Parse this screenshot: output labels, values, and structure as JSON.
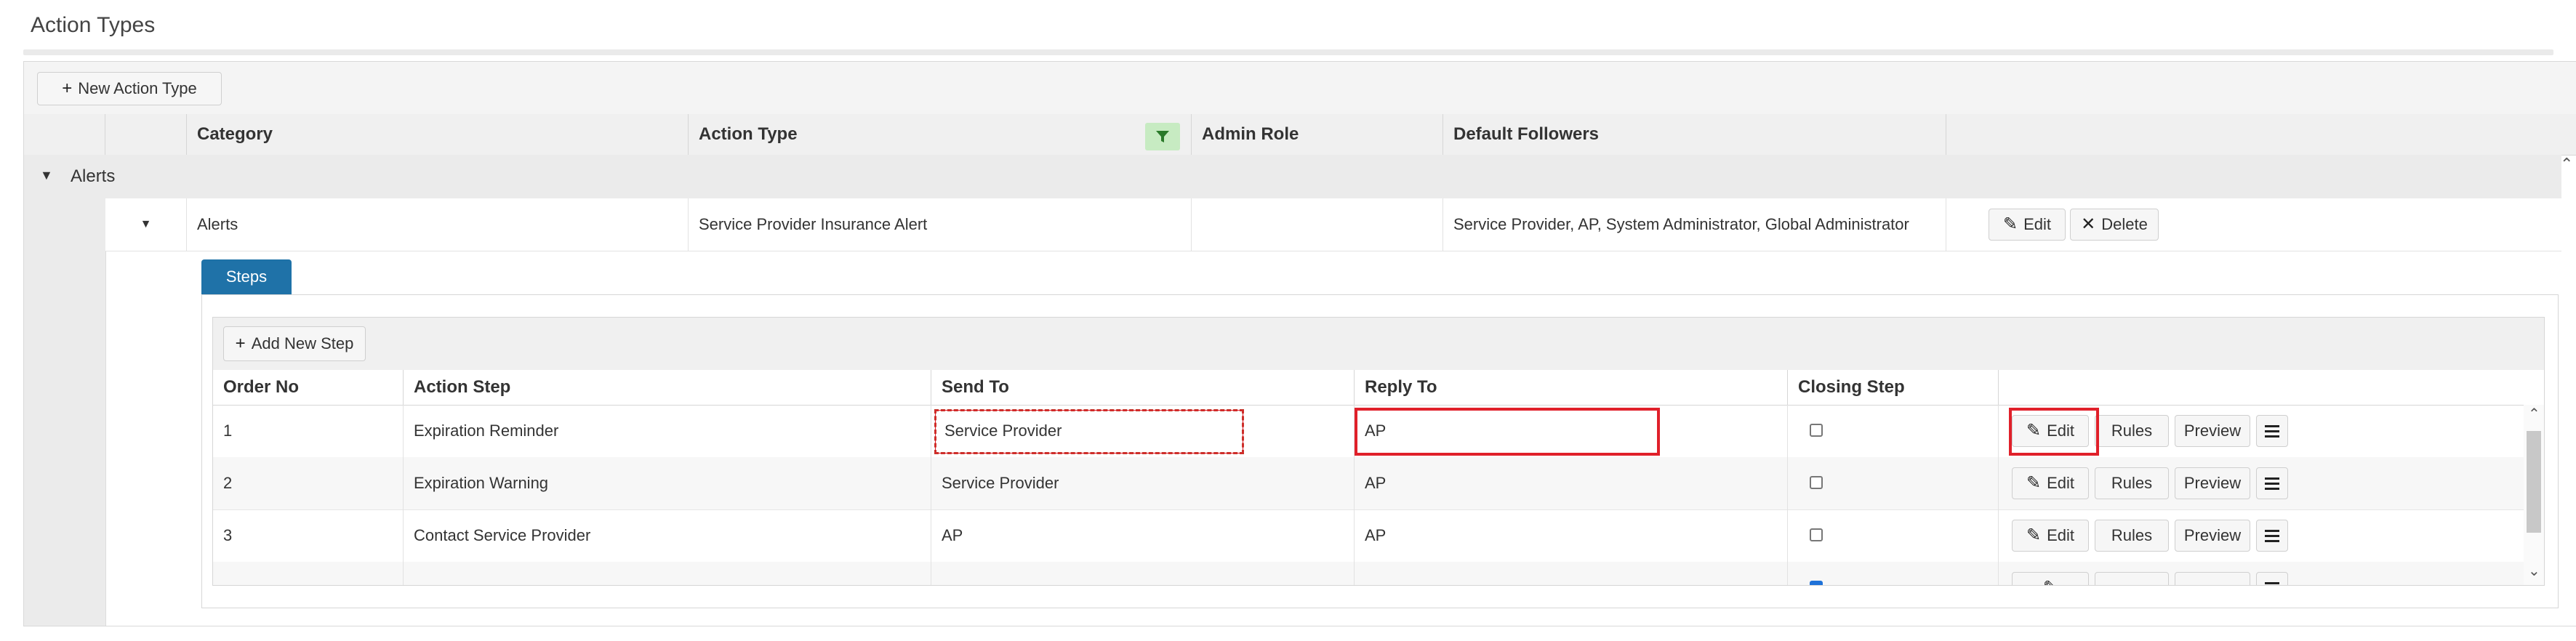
{
  "page_title": "Action Types",
  "toolbar": {
    "new_action_label": "New Action Type"
  },
  "columns": [
    "Category",
    "Action Type",
    "Admin Role",
    "Default Followers",
    ""
  ],
  "group": {
    "label": "Alerts"
  },
  "row": {
    "category": "Alerts",
    "action_type": "Service Provider Insurance Alert",
    "admin_role": "",
    "default_followers": "Service Provider, AP, System Administrator, Global Administrator",
    "edit_label": "Edit",
    "delete_label": "Delete"
  },
  "steps": {
    "tab_label": "Steps",
    "add_label": "Add New Step",
    "columns": [
      "Order No",
      "Action Step",
      "Send To",
      "Reply To",
      "Closing Step",
      ""
    ],
    "rows": [
      {
        "order": "1",
        "action_step": "Expiration Reminder",
        "send_to": "Service Provider",
        "reply_to": "AP",
        "closing": false
      },
      {
        "order": "2",
        "action_step": "Expiration Warning",
        "send_to": "Service Provider",
        "reply_to": "AP",
        "closing": false
      },
      {
        "order": "3",
        "action_step": "Contact Service Provider",
        "send_to": "AP",
        "reply_to": "AP",
        "closing": false
      },
      {
        "order": "",
        "action_step": "",
        "send_to": "",
        "reply_to": "",
        "closing": true
      }
    ],
    "buttons": {
      "edit": "Edit",
      "rules": "Rules",
      "preview": "Preview"
    }
  },
  "colors": {
    "accent": "#1f72a8",
    "highlight": "#e0202a",
    "filter": "#c7ebc2"
  }
}
